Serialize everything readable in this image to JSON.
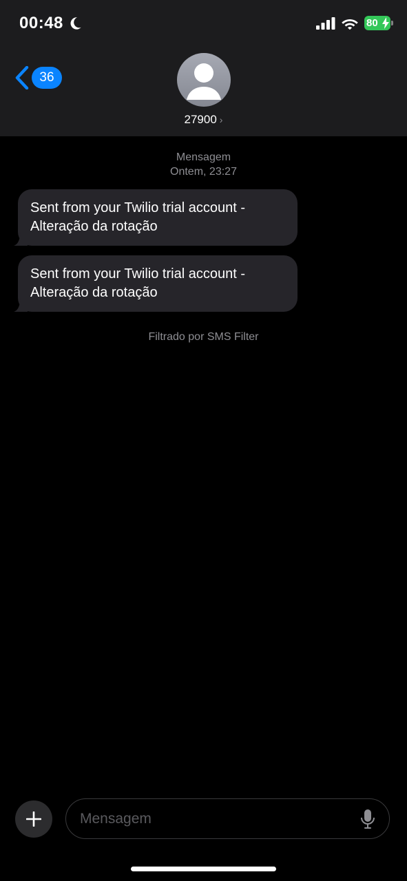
{
  "status_bar": {
    "time": "00:48",
    "battery_level": "80",
    "battery_color": "#34c759",
    "icons": [
      "moon-icon",
      "signal-icon",
      "wifi-icon",
      "battery-icon",
      "bolt-icon"
    ]
  },
  "nav": {
    "back_count": "36",
    "contact_name": "27900",
    "accent_color": "#0a84ff"
  },
  "conversation": {
    "header_label": "Mensagem",
    "header_time": "Ontem, 23:27",
    "messages": [
      {
        "text": "Sent from your Twilio trial account - Alteração da rotação"
      },
      {
        "text": "Sent from your Twilio trial account - Alteração da rotação"
      }
    ],
    "filter_note": "Filtrado por SMS Filter"
  },
  "composer": {
    "placeholder": "Mensagem",
    "value": ""
  }
}
